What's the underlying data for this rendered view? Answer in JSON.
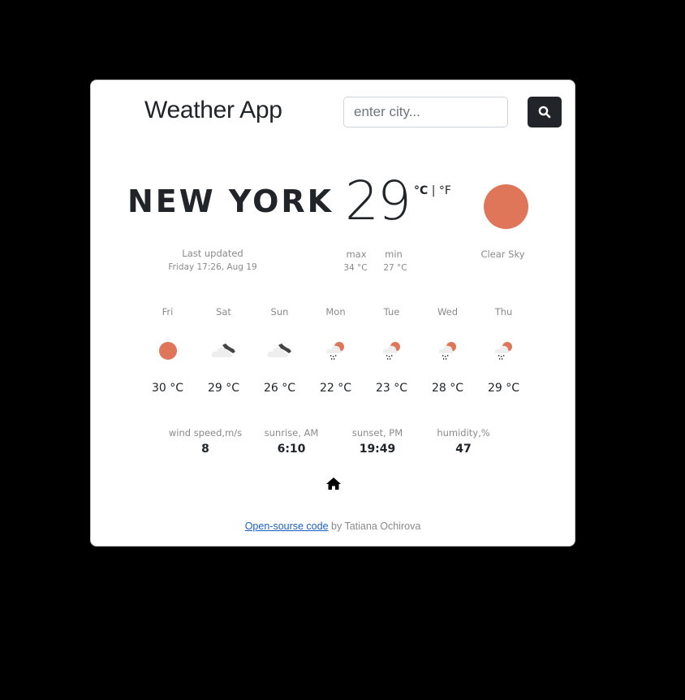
{
  "header": {
    "title": "Weather App",
    "search_placeholder": "enter city...",
    "search_value": "",
    "search_button_icon": "search-icon"
  },
  "current": {
    "city": "NEW YORK",
    "temperature": "29",
    "unit_celsius": "°C",
    "unit_separator": "|",
    "unit_fahrenheit": "°F",
    "active_unit": "celsius",
    "icon": "clear-sky-sun-icon",
    "last_updated_label": "Last updated",
    "last_updated_value": "Friday 17:26, Aug 19",
    "max_label": "max",
    "max_value": "34 °C",
    "min_label": "min",
    "min_value": "27 °C",
    "description": "Clear Sky"
  },
  "forecast": [
    {
      "day": "Fri",
      "temp": "30 °C",
      "icon": "sun-icon"
    },
    {
      "day": "Sat",
      "temp": "29 °C",
      "icon": "cloud-night-icon"
    },
    {
      "day": "Sun",
      "temp": "26 °C",
      "icon": "cloud-night-icon"
    },
    {
      "day": "Mon",
      "temp": "22 °C",
      "icon": "rain-sun-cloud-icon"
    },
    {
      "day": "Tue",
      "temp": "23 °C",
      "icon": "rain-sun-cloud-icon"
    },
    {
      "day": "Wed",
      "temp": "28 °C",
      "icon": "rain-sun-cloud-icon"
    },
    {
      "day": "Thu",
      "temp": "29 °C",
      "icon": "rain-sun-cloud-icon"
    }
  ],
  "stats": [
    {
      "label": "wind speed,m/s",
      "value": "8"
    },
    {
      "label": "sunrise, AM",
      "value": "6:10"
    },
    {
      "label": "sunset, PM",
      "value": "19:49"
    },
    {
      "label": "humidity,%",
      "value": "47"
    }
  ],
  "footer": {
    "link_text": "Open-sourse code",
    "suffix": " by Tatiana Ochirova"
  },
  "colors": {
    "sun": "#df7659",
    "dark": "#212529",
    "muted": "#8a8a8a",
    "link": "#1a5fc8"
  }
}
